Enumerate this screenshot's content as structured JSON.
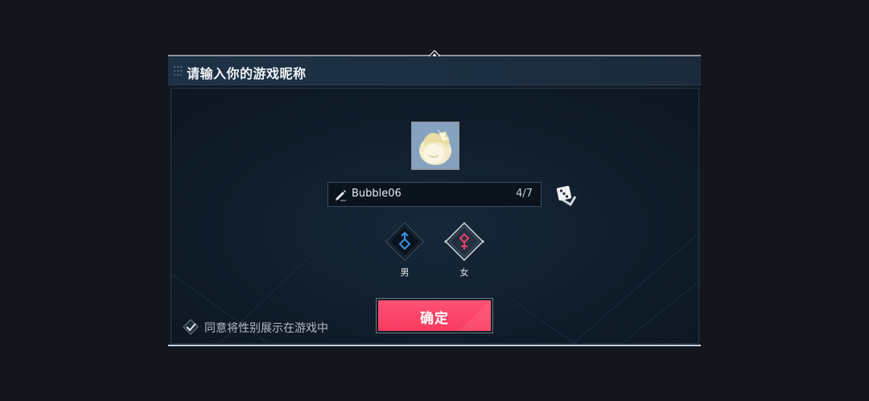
{
  "dialog": {
    "title": "请输入你的游戏昵称",
    "nickname": {
      "value": "Bubble06",
      "counter": "4/7"
    },
    "genders": [
      {
        "label": "男",
        "icon": "male-symbol-icon",
        "color": "#3a8fe0",
        "selected": false
      },
      {
        "label": "女",
        "icon": "female-symbol-icon",
        "color": "#e8416a",
        "selected": true
      }
    ],
    "confirm_label": "确定",
    "agree": {
      "checked": true,
      "label": "同意将性别展示在游戏中"
    },
    "colors": {
      "accent": "#f73c61",
      "panel": "#0f1924",
      "header": "#1e3246"
    }
  }
}
